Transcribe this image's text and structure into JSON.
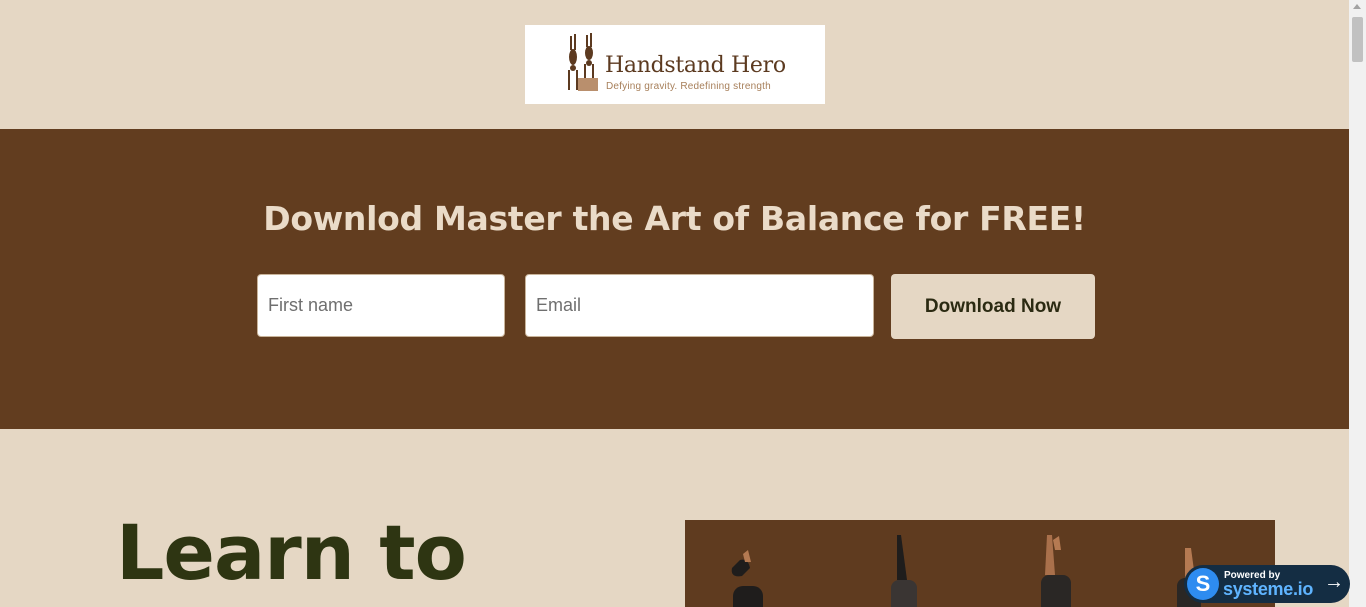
{
  "logo": {
    "title": "Handstand Hero",
    "tagline": "Defying gravity. Redefining strength"
  },
  "hero": {
    "title": "Downlod Master the Art of Balance for FREE!",
    "first_name_placeholder": "First name",
    "email_placeholder": "Email",
    "cta_label": "Download Now"
  },
  "section": {
    "heading": "Learn to"
  },
  "badge": {
    "icon": "S",
    "powered_by": "Powered by",
    "brand": "systeme.io",
    "arrow": "→"
  },
  "colors": {
    "page_bg": "#e5d7c4",
    "hero_bg": "#623d1f",
    "heading": "#2e3512",
    "hero_title": "#eadbc8"
  }
}
